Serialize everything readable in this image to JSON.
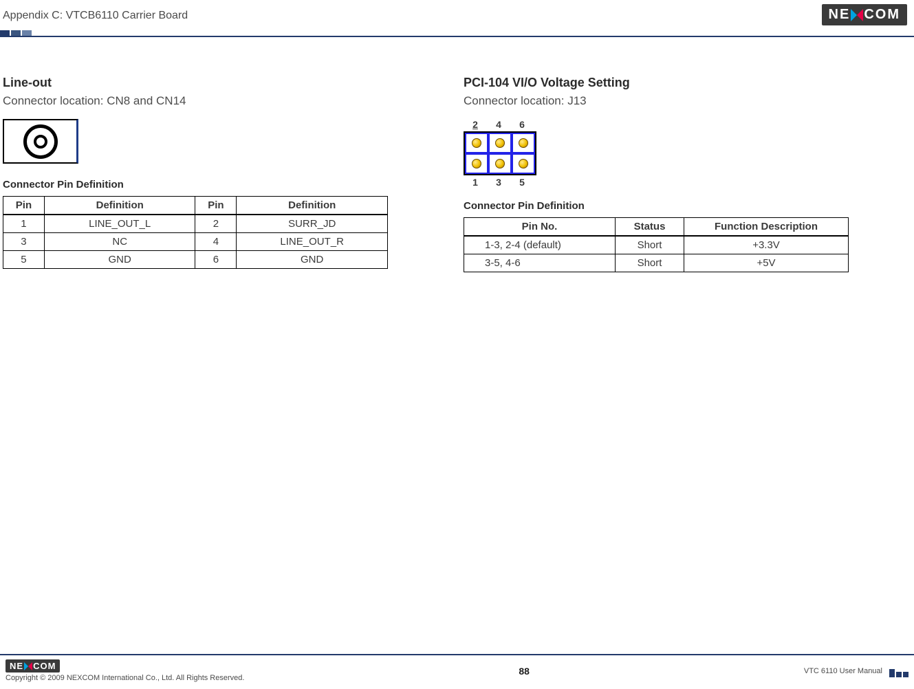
{
  "header": {
    "appendix_title": "Appendix C: VTCB6110 Carrier Board",
    "logo_left": "NE",
    "logo_right": "COM"
  },
  "left": {
    "section_title": "Line-out",
    "connector_location": "Connector location: CN8 and CN14",
    "table_title": "Connector Pin Definition",
    "headers": {
      "pin": "Pin",
      "def": "Definition"
    },
    "rows": [
      {
        "p1": "1",
        "d1": "LINE_OUT_L",
        "p2": "2",
        "d2": "SURR_JD"
      },
      {
        "p1": "3",
        "d1": "NC",
        "p2": "4",
        "d2": "LINE_OUT_R"
      },
      {
        "p1": "5",
        "d1": "GND",
        "p2": "6",
        "d2": "GND"
      }
    ]
  },
  "right": {
    "section_title": "PCI-104 VI/O Voltage Setting",
    "connector_location": "Connector location: J13",
    "j13": {
      "top": [
        "2",
        "4",
        "6"
      ],
      "bot": [
        "1",
        "3",
        "5"
      ]
    },
    "table_title": "Connector Pin Definition",
    "headers": {
      "pinno": "Pin No.",
      "status": "Status",
      "func": "Function Description"
    },
    "rows": [
      {
        "pinno": "1-3, 2-4 (default)",
        "status": "Short",
        "func": "+3.3V"
      },
      {
        "pinno": "3-5, 4-6",
        "status": "Short",
        "func": "+5V"
      }
    ]
  },
  "footer": {
    "copyright": "Copyright © 2009 NEXCOM International Co., Ltd. All Rights Reserved.",
    "page": "88",
    "manual": "VTC 6110 User Manual"
  }
}
